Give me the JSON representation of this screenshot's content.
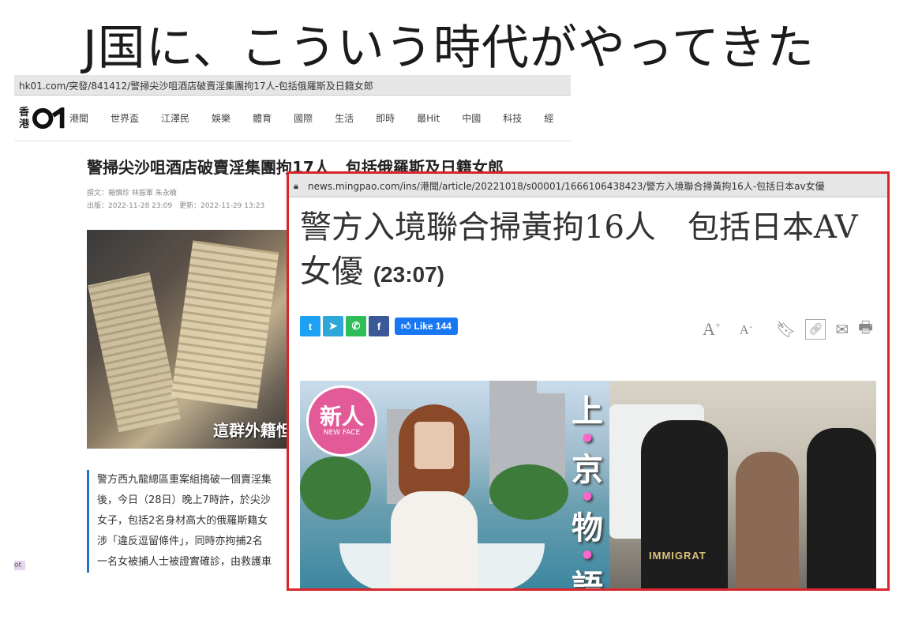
{
  "slide": {
    "headline": "J国に、こういう時代がやってきた"
  },
  "hk01": {
    "url": "hk01.com/突發/841412/警掃尖沙咀酒店破賣淫集團拘17人-包括俄羅斯及日籍女郎",
    "logo_text_top": "香",
    "logo_text_bottom": "港",
    "nav_items": [
      "港聞",
      "世界盃",
      "江澤民",
      "娛樂",
      "體育",
      "國際",
      "生活",
      "即時",
      "最Hit",
      "中國",
      "科技",
      "經"
    ],
    "title": "警掃尖沙咀酒店破賣淫集團拘17人　包括俄羅斯及日籍女郎",
    "meta_author": "撰文：楊慎珍 林振軍 朱永楠",
    "meta_dates": "出版：2022-11-28 23:09　更新：2022-11-29 13:23",
    "photo_caption": "這群外籍怛",
    "body_lines": [
      "警方西九龍總區重案組搗破一個賣淫集",
      "後，今日（28日）晚上7時許，於尖沙",
      "女子，包括2名身材高大的俄羅斯籍女",
      "涉「違反逗留條件」，同時亦拘捕2名",
      "一名女被捕人士被證實確診，由救護車"
    ],
    "stub_text": "ot"
  },
  "mingpao": {
    "url": "news.mingpao.com/ins/港聞/article/20221018/s00001/1666106438423/警方入境聯合掃黃拘16人-包括日本av女優",
    "title": "警方入境聯合掃黃拘16人　包括日本AV女優",
    "time": "(23:07)",
    "share_icons": {
      "twitter": "twitter-icon",
      "telegram": "telegram-icon",
      "whatsapp": "whatsapp-icon",
      "facebook": "facebook-icon"
    },
    "like_label": "Like 144",
    "tools": {
      "font_increase": "A",
      "font_decrease": "A"
    },
    "photo_badge_main": "新人",
    "photo_badge_sub": "NEW FACE",
    "photo_vertical_text": [
      "上",
      "京",
      "物",
      "語"
    ],
    "photo_right_label": "IMMIGRAT"
  },
  "colors": {
    "highlight_border": "#d9252b",
    "like_blue": "#1877f2",
    "hk_accent": "#2a72c4"
  }
}
